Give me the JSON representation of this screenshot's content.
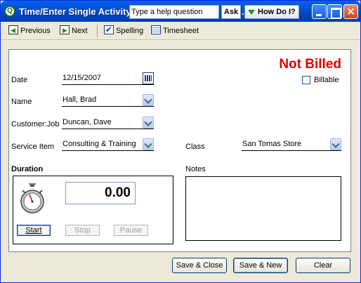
{
  "window": {
    "title": "Time/Enter Single Activity",
    "title_tail": "...)",
    "help_placeholder": "Type a help question",
    "ask_label": "Ask",
    "how_do_i_label": "How Do I?"
  },
  "toolbar": {
    "previous": "Previous",
    "next": "Next",
    "spelling": "Spelling",
    "timesheet": "Timesheet"
  },
  "form": {
    "status": "Not Billed",
    "status_color": "#e00000",
    "billable_label": "Billable",
    "billable_checked": false,
    "date_label": "Date",
    "date_value": "12/15/2007",
    "name_label": "Name",
    "name_value": "Hall, Brad",
    "customer_label": "Customer:Job",
    "customer_value": "Duncan, Dave",
    "service_label": "Service Item",
    "service_value": "Consulting & Training",
    "class_label": "Class",
    "class_value": "San Tomas Store",
    "duration_label": "Duration",
    "duration_value": "0.00",
    "notes_label": "Notes",
    "notes_value": ""
  },
  "timer": {
    "start": "Start",
    "stop": "Stop",
    "pause": "Pause"
  },
  "buttons": {
    "save_close": "Save & Close",
    "save_new": "Save & New",
    "clear": "Clear"
  }
}
